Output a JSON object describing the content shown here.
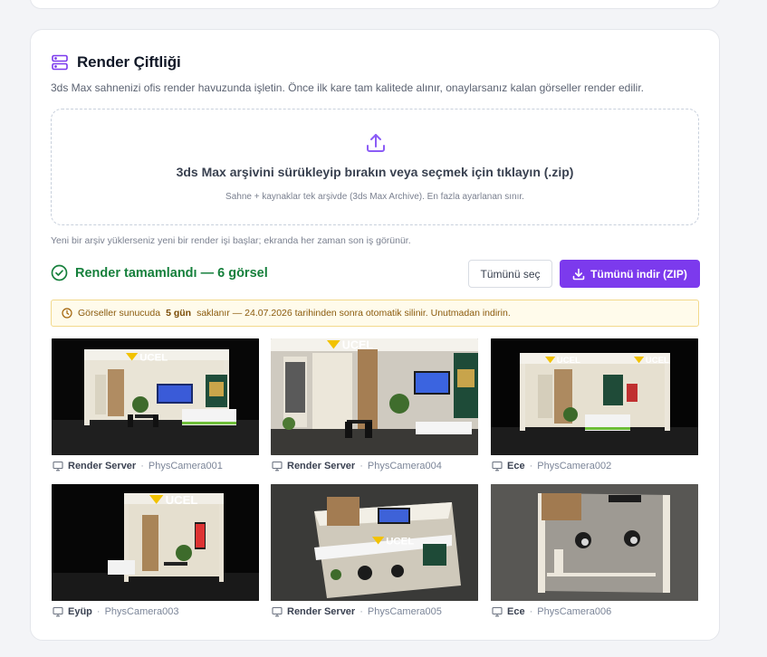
{
  "colors": {
    "accent": "#7c3aed",
    "success": "#16803c",
    "warning_bg": "#fffbeb",
    "warning_border": "#f2d98c"
  },
  "header": {
    "icon": "server-stack-icon",
    "title": "Render Çiftliği",
    "subtitle": "3ds Max sahnenizi ofis render havuzunda işletin. Önce ilk kare tam kalitede alınır, onaylarsanız kalan görseller render edilir."
  },
  "dropzone": {
    "icon": "upload-icon",
    "main": "3ds Max arşivini sürükleyip bırakın veya seçmek için tıklayın (.zip)",
    "sub": "Sahne + kaynaklar tek arşivde (3ds Max Archive). En fazla ayarlanan sınır."
  },
  "hint": "Yeni bir arşiv yüklerseniz yeni bir render işi başlar; ekranda her zaman son iş görünür.",
  "status": {
    "icon": "check-circle-icon",
    "text": "Render tamamlandı — 6 görsel"
  },
  "actions": {
    "select_all": "Tümünü seç",
    "download_all": "Tümünü indir (ZIP)",
    "download_icon": "download-icon"
  },
  "notice": {
    "icon": "clock-icon",
    "before": "Görseller sunucuda",
    "bold": "5 gün",
    "after": "saklanır — 24.07.2026 tarihinden sonra otomatik silinir. Unutmadan indirin."
  },
  "renders": [
    {
      "server": "Render Server",
      "camera": "PhysCamera001",
      "view": "front"
    },
    {
      "server": "Render Server",
      "camera": "PhysCamera004",
      "view": "close-left"
    },
    {
      "server": "Ece",
      "camera": "PhysCamera002",
      "view": "wide"
    },
    {
      "server": "Eyüp",
      "camera": "PhysCamera003",
      "view": "side"
    },
    {
      "server": "Render Server",
      "camera": "PhysCamera005",
      "view": "top-angle"
    },
    {
      "server": "Ece",
      "camera": "PhysCamera006",
      "view": "top-down"
    }
  ],
  "render_brand": "UCEL",
  "separator": "·",
  "monitor_icon": "monitor-icon"
}
